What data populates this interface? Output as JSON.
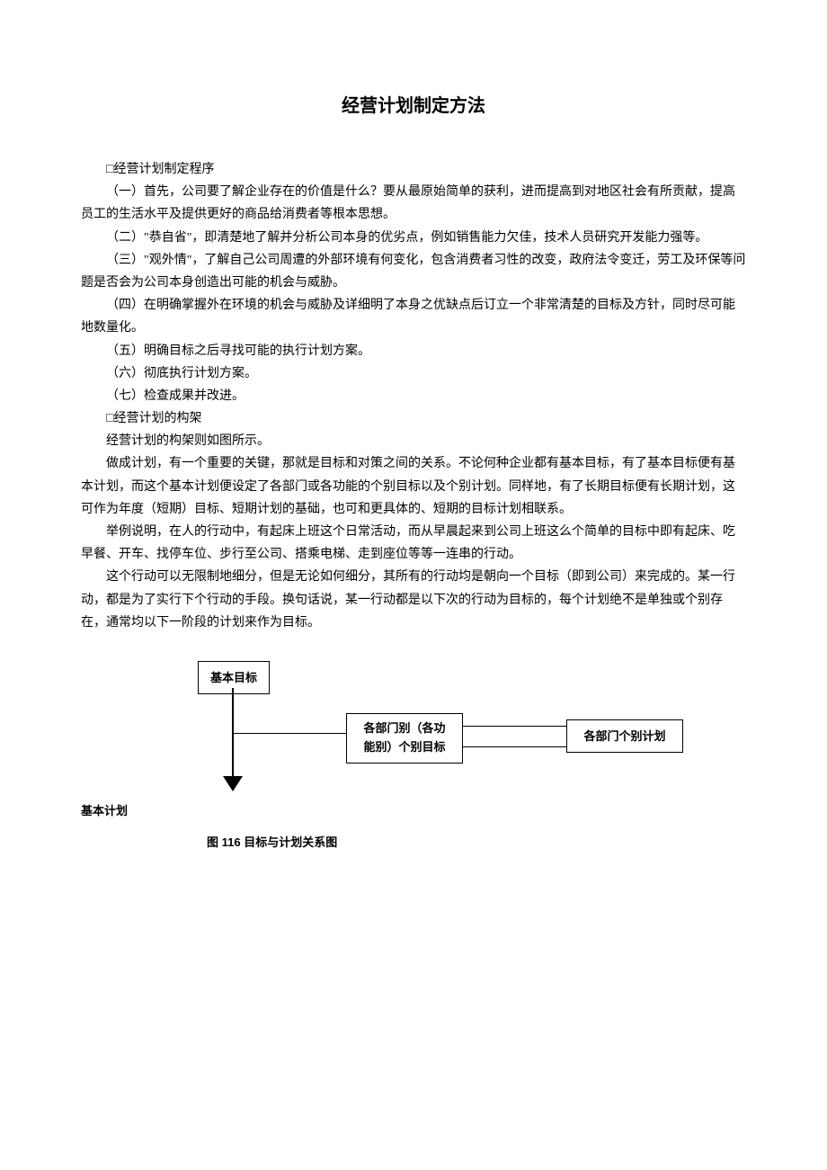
{
  "title": "经营计划制定方法",
  "paragraphs": {
    "p1": "□经营计划制定程序",
    "p2": "（一）首先，公司要了解企业存在的价值是什么？要从最原始简单的获利，进而提高到对地区社会有所贡献，提高员工的生活水平及提供更好的商品给消费者等根本思想。",
    "p3": "（二）\"恭自省\"，即清楚地了解并分析公司本身的优劣点，例如销售能力欠佳，技术人员研究开发能力强等。",
    "p4": "（三）\"观外情\"，了解自己公司周遭的外部环境有何变化，包含消费者习性的改变，政府法令变迁，劳工及环保等问题是否会为公司本身创造出可能的机会与威胁。",
    "p5": "（四）在明确掌握外在环境的机会与威胁及详细明了本身之优缺点后订立一个非常清楚的目标及方针，同时尽可能地数量化。",
    "p6": "（五）明确目标之后寻找可能的执行计划方案。",
    "p7": "（六）彻底执行计划方案。",
    "p8": "（七）检查成果并改进。",
    "p9": "□经营计划的构架",
    "p10": "经营计划的构架则如图所示。",
    "p11": "做成计划，有一个重要的关键，那就是目标和对策之间的关系。不论何种企业都有基本目标，有了基本目标便有基本计划，而这个基本计划便设定了各部门或各功能的个别目标以及个别计划。同样地，有了长期目标便有长期计划，这可作为年度（短期）目标、短期计划的基础，也可和更具体的、短期的目标计划相联系。",
    "p12": "举例说明，在人的行动中，有起床上班这个日常活动，而从早晨起来到公司上班这么个简单的目标中即有起床、吃早餐、开车、找停车位、步行至公司、搭乘电梯、走到座位等等一连串的行动。",
    "p13": "这个行动可以无限制地细分，但是无论如何细分，其所有的行动均是朝向一个目标（即到公司）来完成的。某一行动，都是为了实行下个行动的手段。换句话说，某一行动都是以下次的行动为目标的，每个计划绝不是单独或个别存在，通常均以下一阶段的计划来作为目标。"
  },
  "diagram": {
    "basic_goal": "基本目标",
    "dept_goal_line1": "各部门别（各功",
    "dept_goal_line2": "能别）个别目标",
    "dept_plan": "各部门个别计划",
    "basic_plan": "基本计划"
  },
  "caption": "图 116 目标与计划关系图"
}
